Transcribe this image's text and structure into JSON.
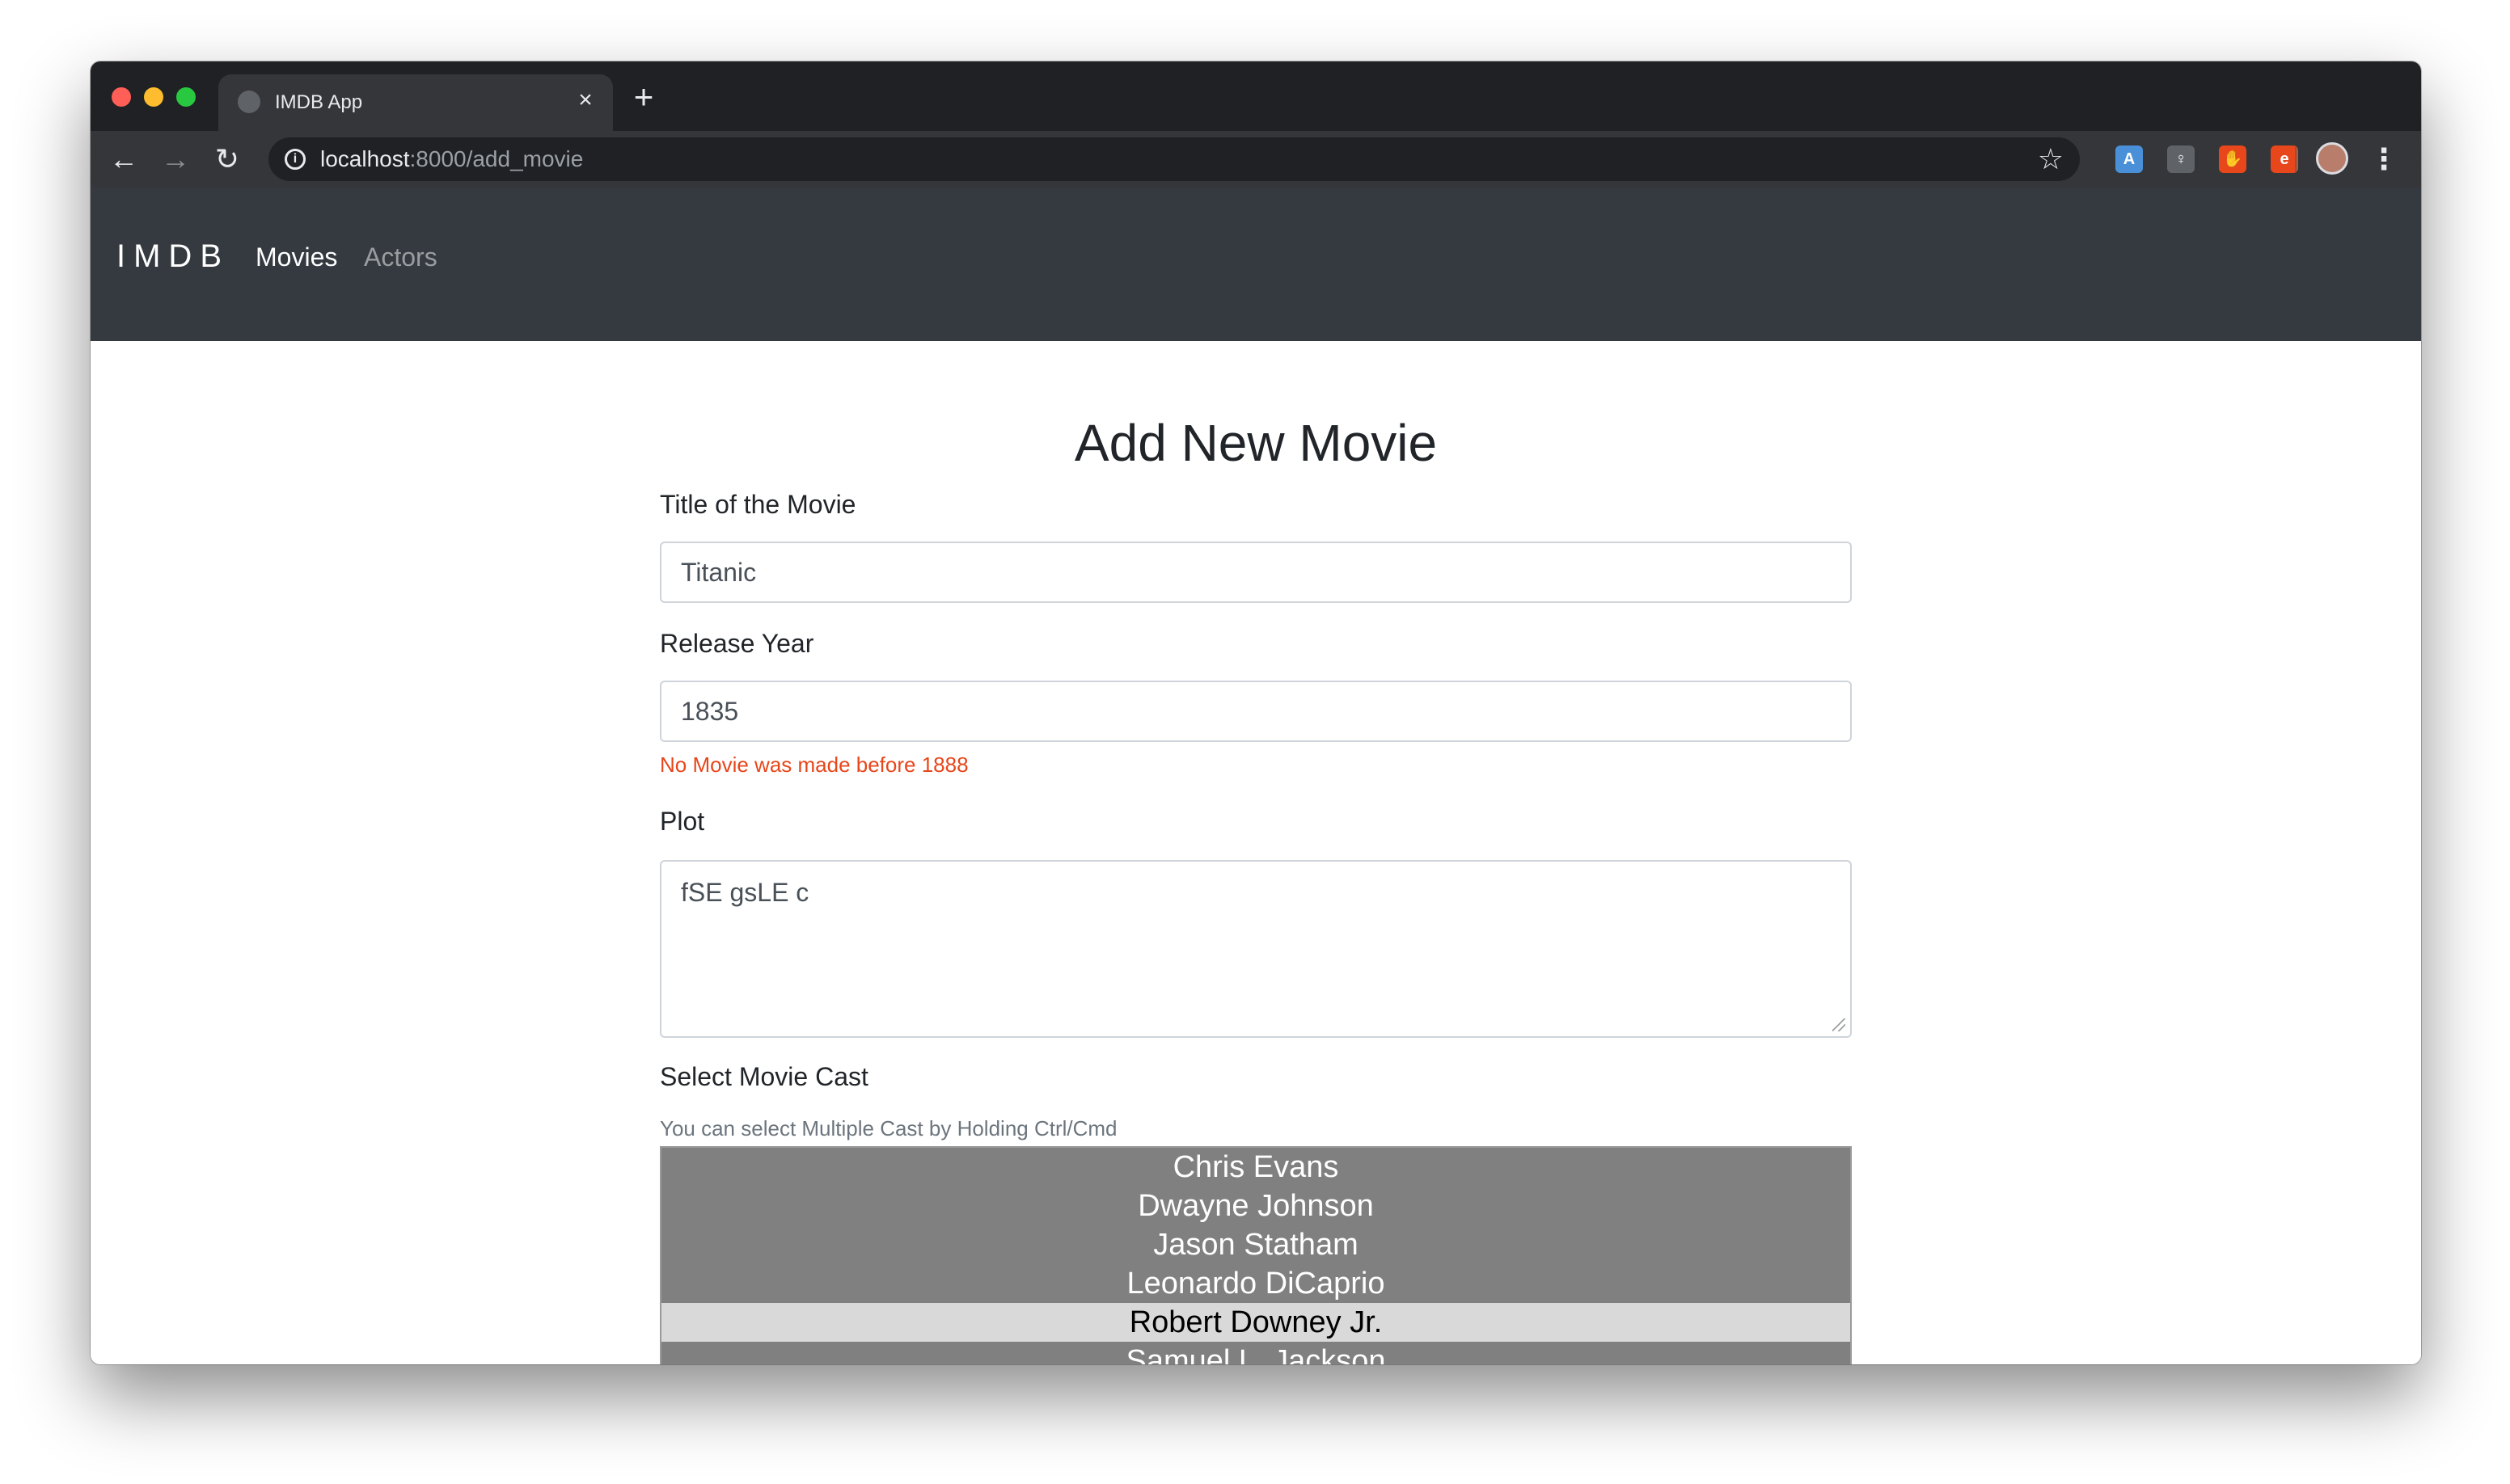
{
  "browser": {
    "tab_title": "IMDB App",
    "tab_close": "×",
    "new_tab": "+",
    "url_host": "localhost",
    "url_path": ":8000/add_movie",
    "icons": {
      "back": "back-arrow-icon",
      "forward": "forward-arrow-icon",
      "reload": "reload-icon",
      "info": "info-icon",
      "bookmark": "star-icon",
      "menu": "kebab-menu-icon"
    },
    "extensions": [
      {
        "name": "extension-a-icon",
        "glyph": "A",
        "color": "#4a90d9"
      },
      {
        "name": "extension-lightbulb-icon",
        "glyph": "♀",
        "color": "#5f6368"
      },
      {
        "name": "extension-hand-icon",
        "glyph": "✋",
        "color": "#e8461b"
      },
      {
        "name": "extension-e-icon",
        "glyph": "e",
        "color": "#e8461b"
      }
    ]
  },
  "navbar": {
    "brand": "IMDB",
    "links": [
      {
        "label": "Movies",
        "active": true
      },
      {
        "label": "Actors",
        "active": false
      }
    ]
  },
  "form": {
    "heading": "Add New Movie",
    "title_label": "Title of the Movie",
    "title_value": "Titanic",
    "year_label": "Release Year",
    "year_value": "1835",
    "year_error": "No Movie was made before 1888",
    "plot_label": "Plot",
    "plot_value": "fSE gsLE c",
    "cast_label": "Select Movie Cast",
    "cast_help": "You can select Multiple Cast by Holding Ctrl/Cmd",
    "cast_options": [
      {
        "label": "Chris Evans",
        "highlighted": false
      },
      {
        "label": "Dwayne Johnson",
        "highlighted": false
      },
      {
        "label": "Jason Statham",
        "highlighted": false
      },
      {
        "label": "Leonardo DiCaprio",
        "highlighted": false
      },
      {
        "label": "Robert Downey Jr.",
        "highlighted": true
      },
      {
        "label": "Samuel L. Jackson",
        "highlighted": false
      }
    ]
  },
  "colors": {
    "error": "#e8461b",
    "navbar_bg": "#343a40",
    "select_bg": "#808080",
    "select_highlight": "#d9d9d9"
  }
}
